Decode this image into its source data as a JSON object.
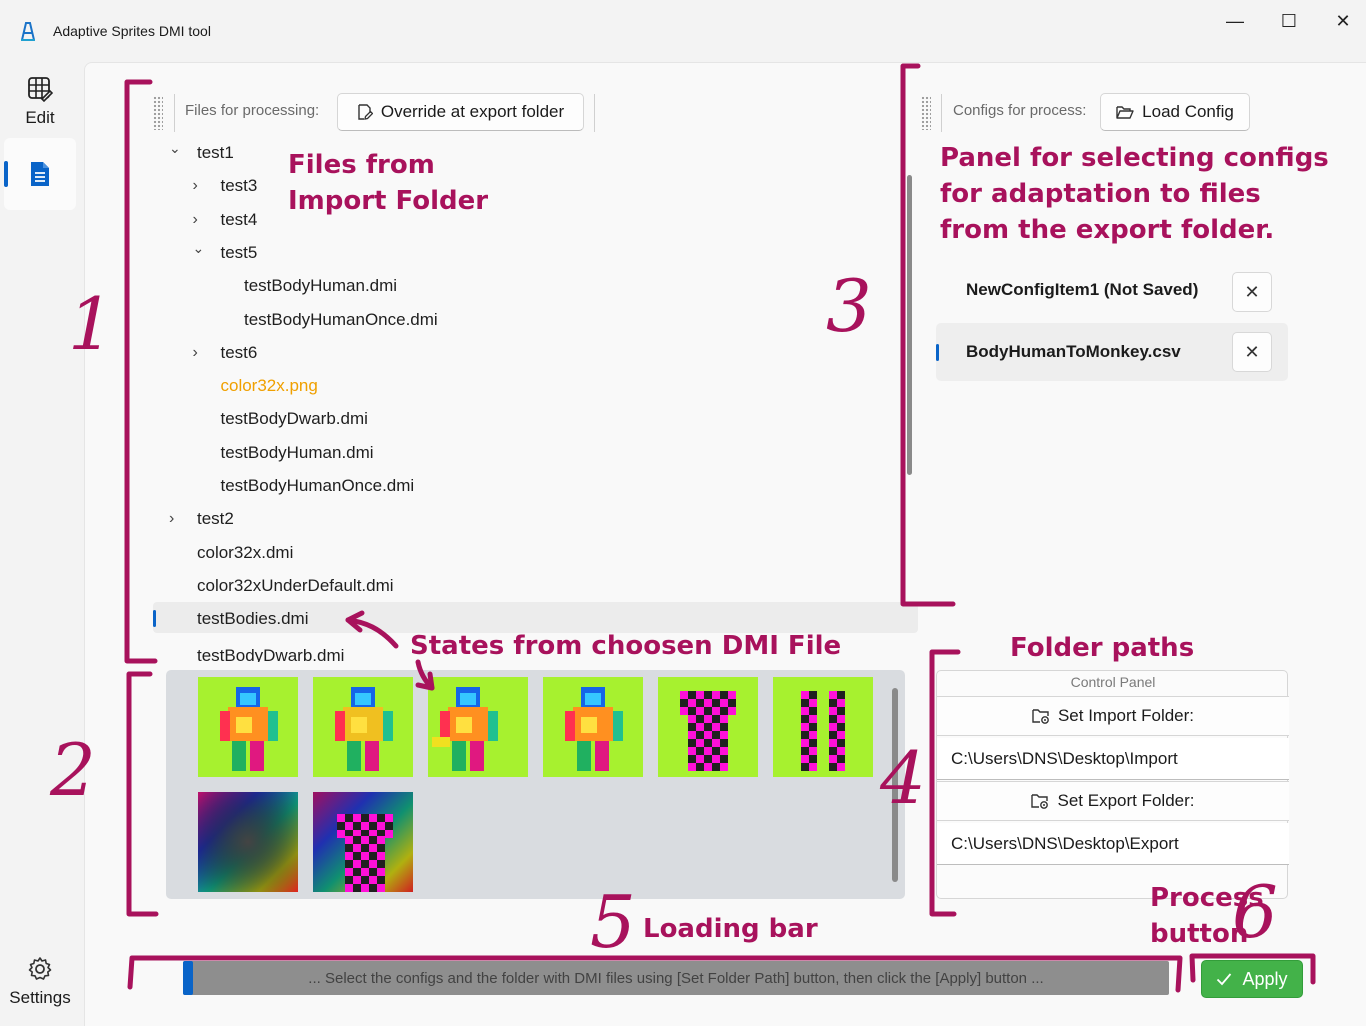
{
  "window": {
    "title": "Adaptive Sprites DMI tool",
    "minimize": "—",
    "maximize": "☐",
    "close": "✕"
  },
  "nav": {
    "edit_label": "Edit",
    "settings_label": "Settings"
  },
  "files_toolbar": {
    "label": "Files for processing:",
    "override_button": "Override at export folder"
  },
  "tree": [
    {
      "label": "test1",
      "chevron": "⌄"
    },
    {
      "label": "test3",
      "chevron": "›"
    },
    {
      "label": "test4",
      "chevron": "›"
    },
    {
      "label": "test5",
      "chevron": "⌄"
    },
    {
      "label": "testBodyHuman.dmi",
      "chevron": ""
    },
    {
      "label": "testBodyHumanOnce.dmi",
      "chevron": ""
    },
    {
      "label": "test6",
      "chevron": "›"
    },
    {
      "label": "color32x.png",
      "chevron": "",
      "color": "#f0a000"
    },
    {
      "label": "testBodyDwarb.dmi",
      "chevron": ""
    },
    {
      "label": "testBodyHuman.dmi",
      "chevron": ""
    },
    {
      "label": "testBodyHumanOnce.dmi",
      "chevron": ""
    },
    {
      "label": "test2",
      "chevron": "›"
    },
    {
      "label": "color32x.dmi",
      "chevron": ""
    },
    {
      "label": "color32xUnderDefault.dmi",
      "chevron": ""
    },
    {
      "label": "testBodies.dmi",
      "chevron": "",
      "selected": true
    },
    {
      "label": "testBodyDwarb.dmi",
      "chevron": ""
    }
  ],
  "configs_toolbar": {
    "label": "Configs for process:",
    "load_button": "Load Config"
  },
  "configs": [
    {
      "name": "NewConfigItem1 (Not Saved)",
      "remove": "✕"
    },
    {
      "name": "BodyHumanToMonkey.csv",
      "remove": "✕",
      "selected": true
    }
  ],
  "control_panel": {
    "title": "Control Panel",
    "import_button": "Set Import Folder:",
    "import_path": "C:\\Users\\DNS\\Desktop\\Import",
    "export_button": "Set Export Folder:",
    "export_path": "C:\\Users\\DNS\\Desktop\\Export"
  },
  "progress": {
    "value": 0.01,
    "text": "... Select the configs and the folder with DMI files using [Set Folder Path] button, then click the [Apply] button ..."
  },
  "apply_button": "Apply",
  "colors": {
    "accent": "#0a64c8",
    "apply_green": "#43b249",
    "annotation": "#a8125c",
    "sprite_bg": "#a7f12f",
    "checker_a": "#ff10d8",
    "checker_b": "#202020"
  },
  "annotations": {
    "files_from": "Files from",
    "import_folder": "Import Folder",
    "panel_line1": "Panel for selecting configs",
    "panel_line2": "for adaptation to files",
    "panel_line3": "from the export folder.",
    "states": "States from choosen DMI File",
    "folder_paths": "Folder paths",
    "loading_bar": "Loading bar",
    "process_line1": "Process",
    "process_line2": "button",
    "n1": "1",
    "n2": "2",
    "n3": "3",
    "n4": "4",
    "n5": "5",
    "n6": "6"
  }
}
